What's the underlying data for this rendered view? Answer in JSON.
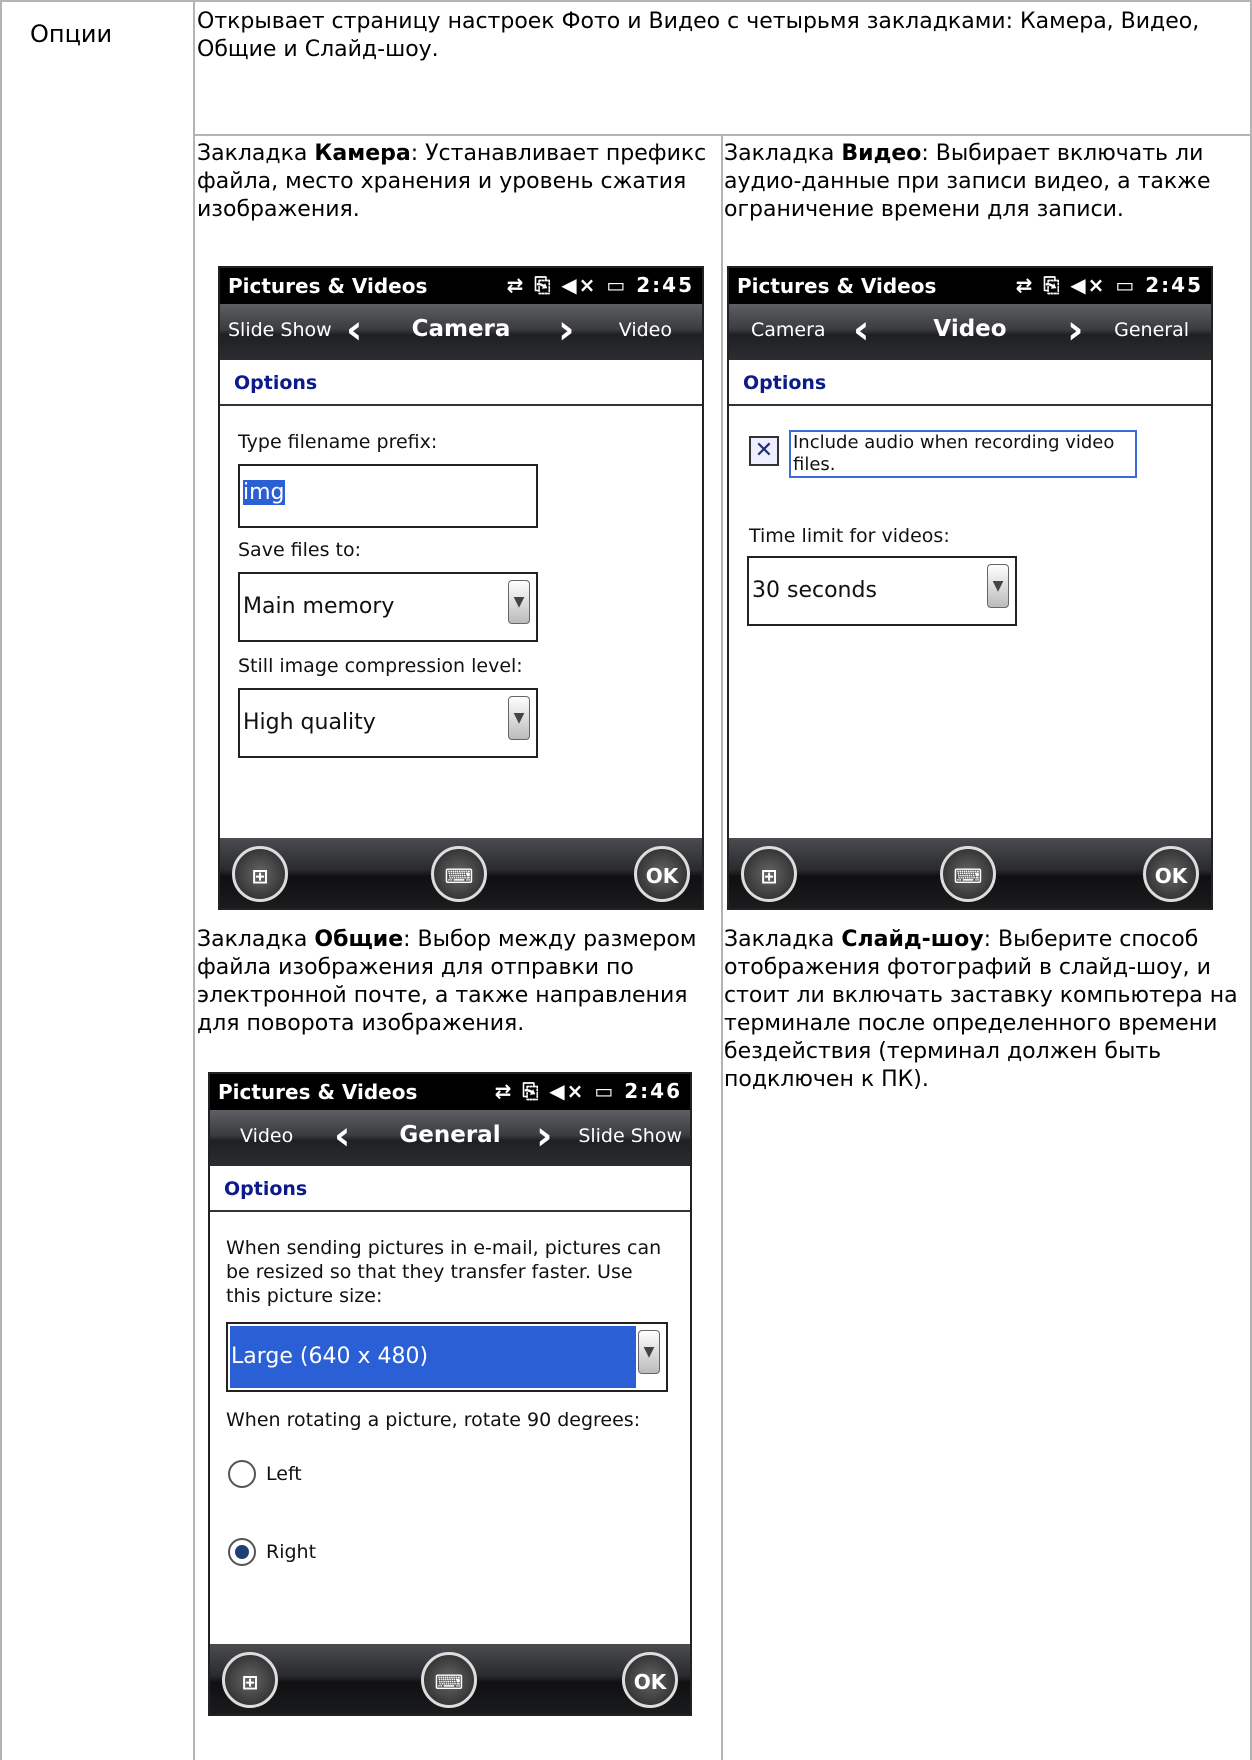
{
  "options_label": "Опции",
  "intro": "Открывает страницу настроек Фото и Видео с четырьмя закладками: Камера, Видео, Общие и Слайд-шоу.",
  "camera_desc": {
    "prefix": "Закладка ",
    "name": "Камера",
    "rest": ": Устанавливает префикс файла, место хранения и уровень сжатия изображения."
  },
  "video_desc": {
    "prefix": "Закладка ",
    "name": "Видео",
    "rest": ": Выбирает включать ли аудио-данные при записи видео, а также ограничение времени для записи."
  },
  "general_desc": {
    "prefix": "Закладка ",
    "name": "Общие",
    "rest": ": Выбор между размером файла изображения для отправки по электронной почте, а также направления для поворота изображения."
  },
  "slideshow_desc": {
    "prefix": "Закладка ",
    "name": "Слайд-шоу",
    "rest": ": Выберите способ отображения фотографий в слайд-шоу, и стоит ли включать заставку компьютера на терминале после определенного времени бездействия (терминал должен быть подключен к ПК)."
  },
  "camera_screen": {
    "app": "Pictures & Videos",
    "time": "2:45",
    "prev": "Slide Show",
    "current": "Camera",
    "next": "Video",
    "options": "Options",
    "prefix_label": "Type filename prefix:",
    "prefix_value": "img",
    "save_label": "Save files to:",
    "save_value": "Main memory",
    "compression_label": "Still image compression level:",
    "compression_value": "High quality",
    "ok": "OK"
  },
  "video_screen": {
    "app": "Pictures & Videos",
    "time": "2:45",
    "prev": "Camera",
    "current": "Video",
    "next": "General",
    "options": "Options",
    "audio_label": "Include audio when recording video files.",
    "audio_checked": true,
    "time_label": "Time limit for videos:",
    "time_value": "30 seconds",
    "ok": "OK"
  },
  "general_screen": {
    "app": "Pictures & Videos",
    "time": "2:46",
    "prev": "Video",
    "current": "General",
    "next": "Slide Show",
    "options": "Options",
    "email_text": "When sending pictures in e-mail, pictures can be resized so that they transfer faster. Use this picture size:",
    "size_value": "Large (640 x 480)",
    "rotate_label": "When rotating a picture, rotate 90 degrees:",
    "left": "Left",
    "right": "Right",
    "rotate_selected": "Right",
    "ok": "OK"
  }
}
